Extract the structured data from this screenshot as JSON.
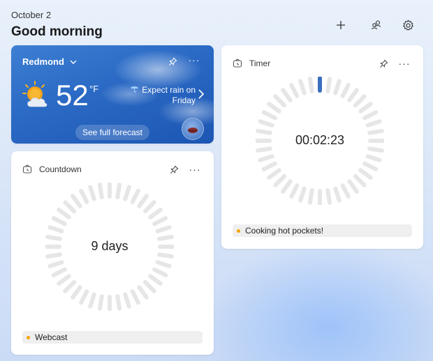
{
  "header": {
    "date": "October 2",
    "greeting": "Good morning",
    "add_icon": "plus-icon",
    "people_icon": "people-icon",
    "settings_icon": "gear-icon"
  },
  "weather": {
    "location": "Redmond",
    "temperature": "52",
    "unit": "°F",
    "forecast_line1": "Expect rain on",
    "forecast_line2": "Friday",
    "forecast_button": "See full forecast",
    "condition_icon": "partly-cloudy-sun-icon"
  },
  "timer": {
    "title": "Timer",
    "time": "00:02:23",
    "label": "Cooking hot pockets!",
    "accent": "#3a6fc0"
  },
  "countdown": {
    "title": "Countdown",
    "value": "9 days",
    "label": "Webcast"
  },
  "colors": {
    "tick": "#e6e6e6",
    "label_dot": "#f5a300"
  }
}
